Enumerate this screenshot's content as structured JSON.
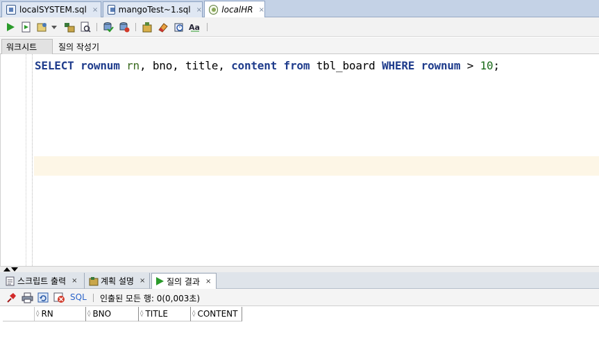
{
  "doc_tabs": [
    {
      "label": "localSYSTEM.sql",
      "close": "×"
    },
    {
      "label": "mangoTest~1.sql",
      "close": "×"
    },
    {
      "label": "localHR",
      "close": "×"
    }
  ],
  "sub_tabs": [
    {
      "label": "워크시트"
    },
    {
      "label": "질의 작성기"
    }
  ],
  "editor": {
    "sql": {
      "select": "SELECT",
      "rownum1": "rownum",
      "rn": "rn",
      "c1": ",",
      "bno": "bno",
      "c2": ",",
      "title": "title",
      "c3": ",",
      "content": "content",
      "from": "from",
      "table": "tbl_board",
      "where": "WHERE",
      "rownum2": "rownum",
      "gt": ">",
      "ten": "10",
      "semicolon": ";"
    }
  },
  "bottom_tabs": [
    {
      "label": "스크립트 출력",
      "close": "×"
    },
    {
      "label": "계획 설명",
      "close": "×"
    },
    {
      "label": "질의 결과",
      "close": "×"
    }
  ],
  "result_toolbar": {
    "sql_label": "SQL",
    "status": "인출된 모든 행: 0(0,003초)"
  },
  "grid": {
    "columns": [
      "RN",
      "BNO",
      "TITLE",
      "CONTENT"
    ],
    "rows": []
  },
  "colors": {
    "keyword": "#1f3c8c",
    "identifier": "#3a6a1f",
    "current_line": "#fdf6e6",
    "tab_bar": "#c4d2e6"
  }
}
